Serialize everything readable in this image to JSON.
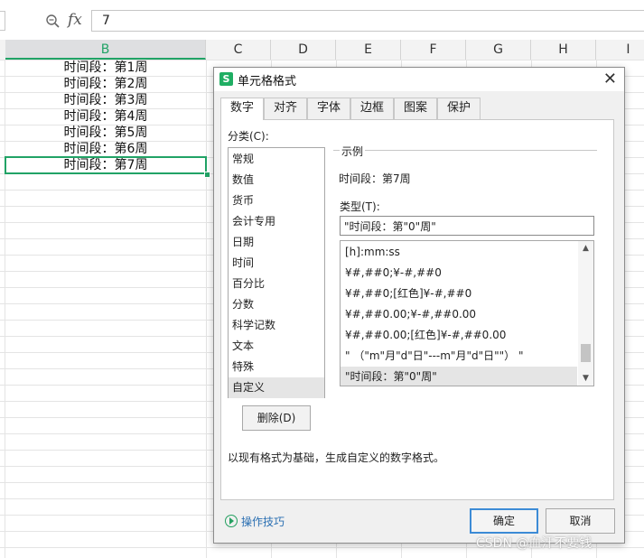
{
  "formula_bar": {
    "fx_label": "fx",
    "value": "7"
  },
  "sheet": {
    "columns": [
      "B",
      "C",
      "D",
      "E",
      "F",
      "G",
      "H",
      "I"
    ],
    "selected_column": "B",
    "cells_b": [
      "时间段：第1周",
      "时间段：第2周",
      "时间段：第3周",
      "时间段：第4周",
      "时间段：第5周",
      "时间段：第6周",
      "时间段：第7周"
    ],
    "active_row_index": 6,
    "accent_color": "#21a366"
  },
  "dialog": {
    "title": "单元格格式",
    "app_icon": "S",
    "close_glyph": "✕",
    "tabs": [
      "数字",
      "对齐",
      "字体",
      "边框",
      "图案",
      "保护"
    ],
    "active_tab": "数字",
    "category_label": "分类(C):",
    "categories": [
      "常规",
      "数值",
      "货币",
      "会计专用",
      "日期",
      "时间",
      "百分比",
      "分数",
      "科学记数",
      "文本",
      "特殊",
      "自定义"
    ],
    "selected_category": "自定义",
    "sample_label": "示例",
    "sample_value": "时间段：第7周",
    "type_label": "类型(T):",
    "type_value": "\"时间段：第\"0\"周\"",
    "type_list": [
      "[h]:mm:ss",
      "¥#,##0;¥-#,##0",
      "¥#,##0;[红色]¥-#,##0",
      "¥#,##0.00;¥-#,##0.00",
      "¥#,##0.00;[红色]¥-#,##0.00",
      "\" （\"m\"月\"d\"日\"---m\"月\"d\"日\"\"） \"",
      "\"时间段：第\"0\"周\""
    ],
    "selected_type_index": 6,
    "delete_button": "删除(D)",
    "description": "以现有格式为基础，生成自定义的数字格式。",
    "tips_link": "操作技巧",
    "ok_button": "确定",
    "cancel_button": "取消"
  },
  "watermark": "CSDN @血汗不要钱"
}
